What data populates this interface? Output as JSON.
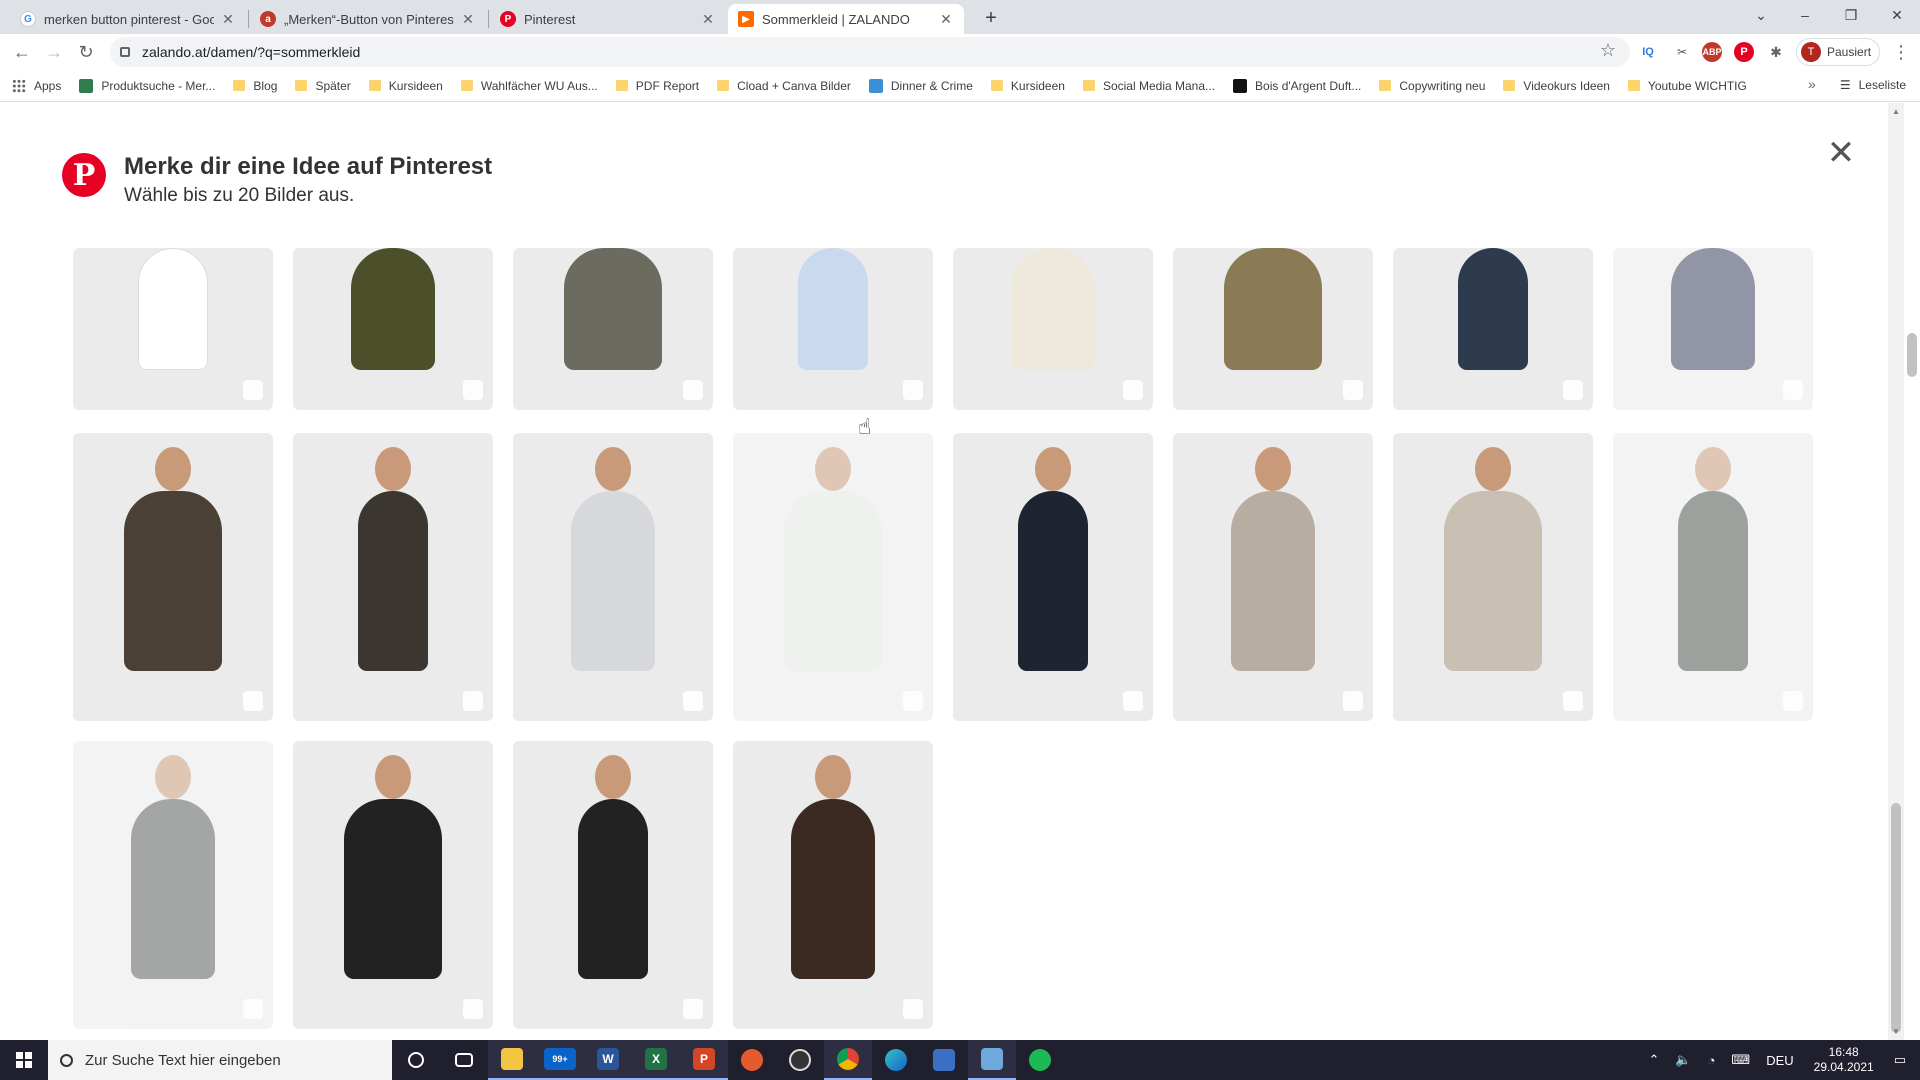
{
  "browser": {
    "tabs": [
      {
        "title": "merken button pinterest - Goog",
        "icon": "google-icon",
        "color": "#4285f4",
        "glyph": "G"
      },
      {
        "title": "„Merken“-Button von Pinterest -",
        "icon": "ahrefs-icon",
        "color": "#c0392b",
        "glyph": "a"
      },
      {
        "title": "Pinterest",
        "icon": "pinterest-icon",
        "color": "#e60023",
        "glyph": "P"
      },
      {
        "title": "Sommerkleid | ZALANDO",
        "icon": "zalando-icon",
        "color": "#ff6900",
        "glyph": "▶"
      }
    ],
    "url": "zalando.at/damen/?q=sommerkleid",
    "profile_label": "Pausiert",
    "profile_initial": "T",
    "bookmarks": [
      {
        "label": "Apps",
        "type": "grid"
      },
      {
        "label": "Produktsuche - Mer...",
        "type": "sq",
        "color": "#2e7d4f"
      },
      {
        "label": "Blog",
        "type": "folder"
      },
      {
        "label": "Später",
        "type": "folder"
      },
      {
        "label": "Kursideen",
        "type": "folder"
      },
      {
        "label": "Wahlfächer WU Aus...",
        "type": "folder"
      },
      {
        "label": "PDF Report",
        "type": "folder"
      },
      {
        "label": "Cload + Canva Bilder",
        "type": "folder"
      },
      {
        "label": "Dinner & Crime",
        "type": "sq",
        "color": "#3d8fd6"
      },
      {
        "label": "Kursideen",
        "type": "folder"
      },
      {
        "label": "Social Media Mana...",
        "type": "folder"
      },
      {
        "label": "Bois d'Argent Duft...",
        "type": "sq",
        "color": "#111111"
      },
      {
        "label": "Copywriting neu",
        "type": "folder"
      },
      {
        "label": "Videokurs Ideen",
        "type": "folder"
      },
      {
        "label": "Youtube WICHTIG",
        "type": "folder"
      }
    ],
    "reading_list": "Leseliste",
    "more_bookmarks": "»"
  },
  "pinterest_modal": {
    "title": "Merke dir eine Idee auf Pinterest",
    "subtitle": "Wähle bis zu 20 Bilder aus.",
    "logo_glyph": "P",
    "close_glyph": "✕",
    "brand_color": "#e60023"
  },
  "taskbar": {
    "search_placeholder": "Zur Suche Text hier eingeben",
    "language": "DEU",
    "time": "16:48",
    "date": "29.04.2021",
    "mail_badge": "99+"
  }
}
